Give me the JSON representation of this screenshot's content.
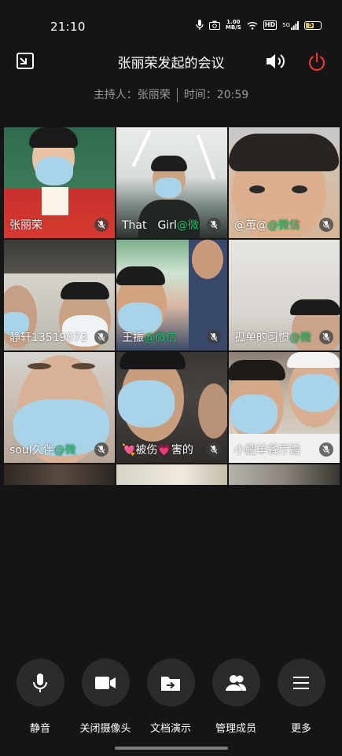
{
  "status_bar": {
    "time": "21:10",
    "net_speed_value": "1.00",
    "net_speed_unit": "MB/S",
    "hd_label": "HD",
    "signal_label": "5G",
    "battery_level": "51"
  },
  "header": {
    "title": "张丽荣发起的会议",
    "host_text": "主持人：张丽荣",
    "time_text": "时间：20:59"
  },
  "participants": [
    {
      "name": "张丽荣",
      "wechat": ""
    },
    {
      "name": "That　Girl",
      "wechat": "@微"
    },
    {
      "name": "@茧@",
      "wechat": "@微信"
    },
    {
      "name": "静轩13519073",
      "wechat": ""
    },
    {
      "name": "王振",
      "wechat": "@微信"
    },
    {
      "name": "孤单的习惯",
      "wechat": "@微"
    },
    {
      "name": "soul久伴",
      "wechat": "@微"
    },
    {
      "name": "💘被伤💗害的",
      "wechat": ""
    },
    {
      "name": "小肥羊餐厅霞",
      "wechat": ""
    }
  ],
  "toolbar": {
    "mute": "静音",
    "camera": "关闭摄像头",
    "share": "文档演示",
    "members": "管理成员",
    "more": "更多"
  },
  "colors": {
    "background": "#151515",
    "accent_red": "#e53935",
    "wechat_green": "#1ec46a"
  },
  "icons": [
    "exit-fullscreen-icon",
    "speaker-icon",
    "power-icon",
    "mic-icon",
    "camera-icon",
    "folder-share-icon",
    "members-icon",
    "menu-icon"
  ]
}
